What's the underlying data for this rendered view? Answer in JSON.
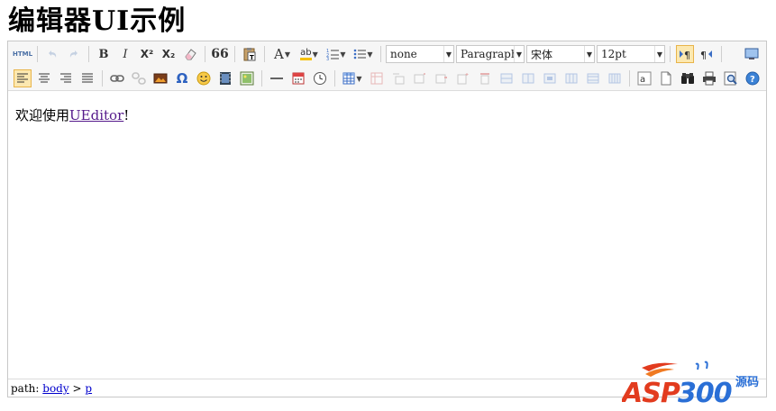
{
  "page": {
    "title": "编辑器UI示例"
  },
  "toolbar": {
    "html_label": "HTML",
    "bold_label": "B",
    "italic_label": "I",
    "superscript_label": "X²",
    "subscript_label": "X₂",
    "quote_label": "66",
    "font_color_label": "A",
    "backcolor_label": "ab",
    "special_char_label": "Ω",
    "customstyle_value": "none",
    "paragraph_value": "Paragraph",
    "fontfamily_value": "宋体",
    "fontsize_value": "12pt"
  },
  "content": {
    "prefix": "欢迎使用",
    "link_text": "UEditor",
    "suffix": "!"
  },
  "statusbar": {
    "path_label": "path:",
    "path_body": "body",
    "path_sep": ">",
    "path_p": "p"
  },
  "watermark": {
    "text": "ASP300",
    "sub_text": "源码"
  },
  "colors": {
    "accent_active": "#fce8b0",
    "link": "#551a8b",
    "watermark_red": "#e23b1e",
    "watermark_blue": "#2a6fd6"
  }
}
